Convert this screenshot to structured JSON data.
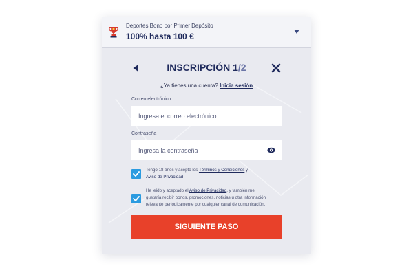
{
  "bonus": {
    "subtitle": "Deportes Bono por Primer Depósito",
    "title": "100% hasta 100 €"
  },
  "form": {
    "title_step": "INSCRIPCIÓN 1",
    "title_total": "/2",
    "login_prompt": "¿Ya tienes una cuenta?",
    "login_link": "Inicia sesión",
    "email": {
      "label": "Correo electrónico",
      "placeholder": "Ingresa el correo electrónico",
      "value": ""
    },
    "password": {
      "label": "Contraseña",
      "placeholder": "Ingresa la contraseña",
      "value": ""
    },
    "terms": {
      "checked": true,
      "text_before": "Tengo 18 años y acepto los ",
      "terms_link": "Términos y Condiciones",
      "text_middle": " y ",
      "privacy_link": "Aviso de Privacidad"
    },
    "marketing": {
      "checked": true,
      "text_before": "He leído y aceptado el ",
      "privacy_link": "Aviso de Privacidad",
      "text_after": ", y también me gustaría recibir bonos, promociones, noticias u otra información relevante periódicamente por cualquier canal de comunicación."
    },
    "submit_label": "SIGUIENTE PASO"
  },
  "colors": {
    "primary": "#1f2a5c",
    "accent": "#e8412a",
    "checkbox": "#2b9be0",
    "panel_bg": "#e9eaf0"
  },
  "icons": [
    "trophy-icon",
    "chevron-down-icon",
    "back-arrow-icon",
    "close-icon",
    "eye-icon",
    "checkmark-icon"
  ]
}
